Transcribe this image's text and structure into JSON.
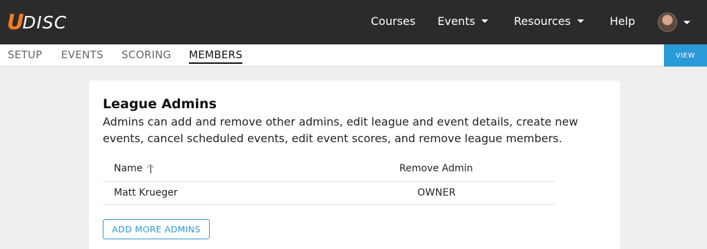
{
  "brand": {
    "u": "U",
    "disc": "DISC",
    "accent": "#f47b20"
  },
  "nav": {
    "courses": "Courses",
    "events": "Events",
    "resources": "Resources",
    "help": "Help"
  },
  "tabs": [
    {
      "label": "SETUP",
      "active": false
    },
    {
      "label": "EVENTS",
      "active": false
    },
    {
      "label": "SCORING",
      "active": false
    },
    {
      "label": "MEMBERS",
      "active": true
    }
  ],
  "view_label": "VIEW",
  "card": {
    "title": "League Admins",
    "description": "Admins can add and remove other admins, edit league and event details, create new events, cancel scheduled events, edit event scores, and remove league members.",
    "table": {
      "col_name": "Name",
      "col_remove": "Remove Admin",
      "rows": [
        {
          "name": "Matt Krueger",
          "role": "OWNER"
        }
      ]
    },
    "add_button": "ADD MORE ADMINS"
  }
}
